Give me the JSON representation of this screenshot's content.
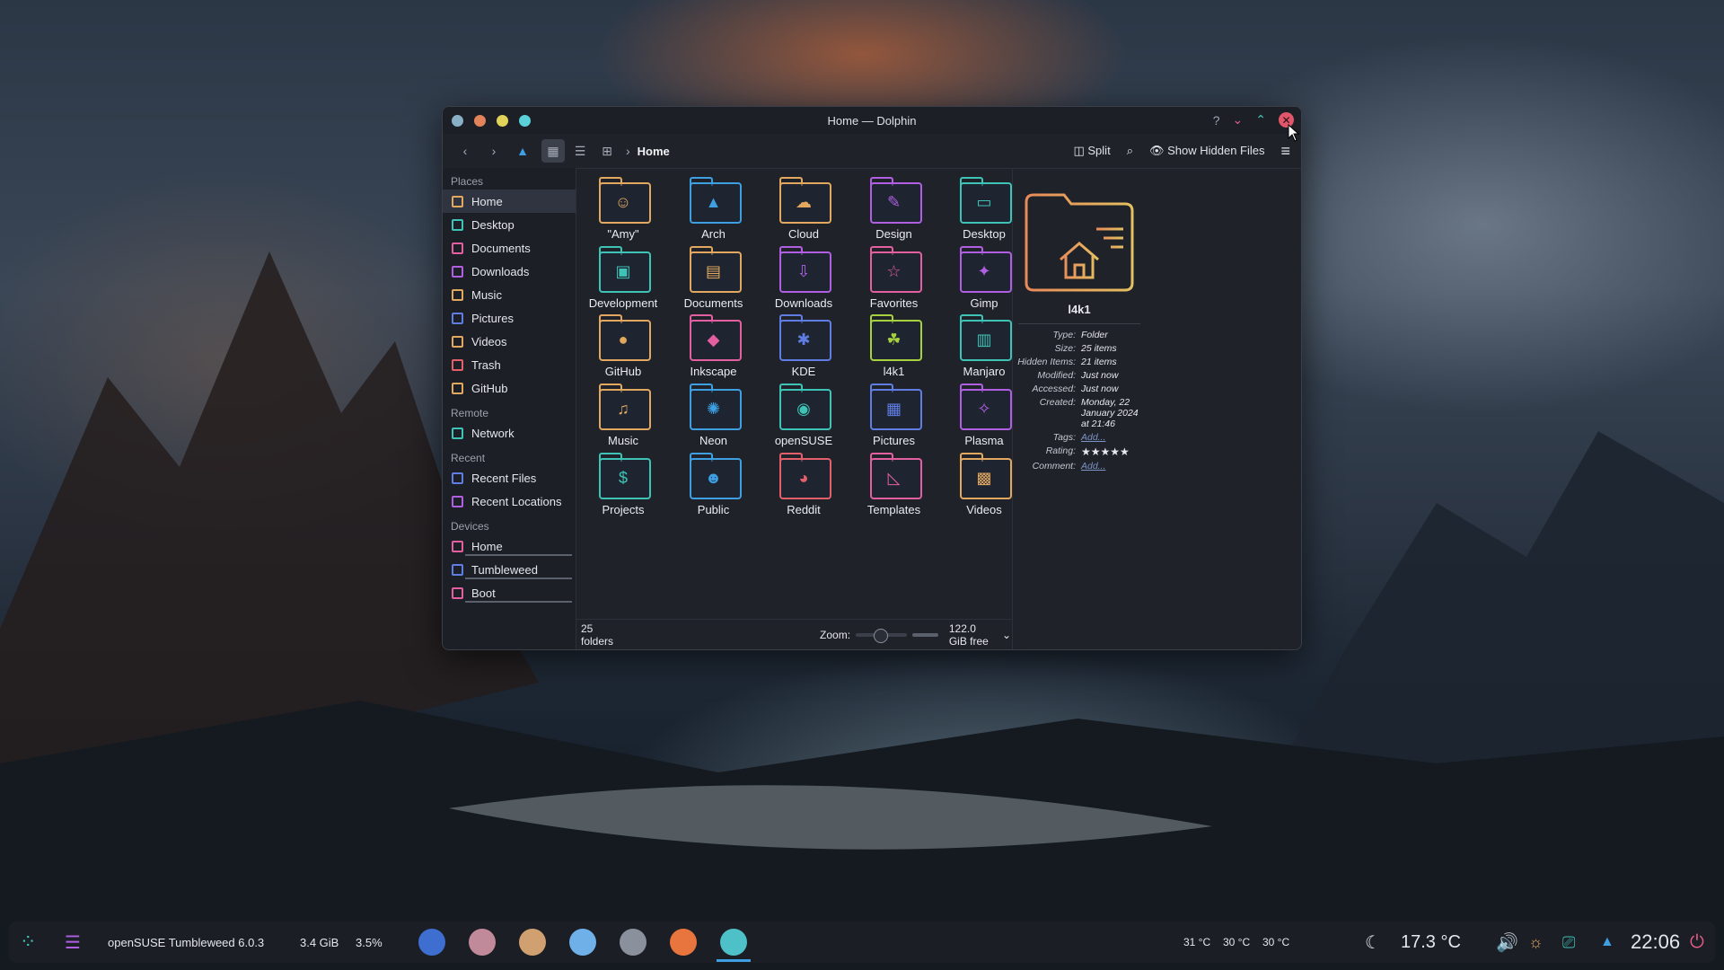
{
  "window": {
    "title": "Home — Dolphin"
  },
  "toolbar": {
    "breadcrumb": "Home",
    "split_label": "Split",
    "hidden_files_label": "Show Hidden Files"
  },
  "sidebar": {
    "places_header": "Places",
    "places": [
      {
        "label": "Home",
        "icon": "home-icon",
        "color": "#e3a860"
      },
      {
        "label": "Desktop",
        "icon": "desktop-icon",
        "color": "#3ec4b6"
      },
      {
        "label": "Documents",
        "icon": "documents-icon",
        "color": "#e35fa0"
      },
      {
        "label": "Downloads",
        "icon": "downloads-icon",
        "color": "#b05fe3"
      },
      {
        "label": "Music",
        "icon": "music-icon",
        "color": "#e3a860"
      },
      {
        "label": "Pictures",
        "icon": "pictures-icon",
        "color": "#5f7de3"
      },
      {
        "label": "Videos",
        "icon": "videos-icon",
        "color": "#e3a860"
      },
      {
        "label": "Trash",
        "icon": "trash-icon",
        "color": "#e35f6a"
      },
      {
        "label": "GitHub",
        "icon": "github-icon",
        "color": "#e3a860"
      }
    ],
    "remote_header": "Remote",
    "remote": [
      {
        "label": "Network",
        "icon": "network-icon",
        "color": "#3ec4b6"
      }
    ],
    "recent_header": "Recent",
    "recent": [
      {
        "label": "Recent Files",
        "icon": "recent-files-icon",
        "color": "#5f7de3"
      },
      {
        "label": "Recent Locations",
        "icon": "recent-locations-icon",
        "color": "#b05fe3"
      }
    ],
    "devices_header": "Devices",
    "devices": [
      {
        "label": "Home",
        "icon": "drive-icon",
        "color": "#e35fa0"
      },
      {
        "label": "Tumbleweed",
        "icon": "drive-icon",
        "color": "#5f7de3"
      },
      {
        "label": "Boot",
        "icon": "drive-icon",
        "color": "#e35fa0"
      }
    ]
  },
  "folders": [
    {
      "label": "\"Amy\"",
      "glyph": "☺",
      "color": "#e3a860"
    },
    {
      "label": "Arch",
      "glyph": "▲",
      "color": "#3e9fe3"
    },
    {
      "label": "Cloud",
      "glyph": "☁",
      "color": "#e3a860"
    },
    {
      "label": "Design",
      "glyph": "✎",
      "color": "#b05fe3"
    },
    {
      "label": "Desktop",
      "glyph": "▭",
      "color": "#3ec4b6"
    },
    {
      "label": "Development",
      "glyph": "▣",
      "color": "#3ec4b6"
    },
    {
      "label": "Documents",
      "glyph": "▤",
      "color": "#e3a860"
    },
    {
      "label": "Downloads",
      "glyph": "⇩",
      "color": "#b05fe3"
    },
    {
      "label": "Favorites",
      "glyph": "☆",
      "color": "#e35fa0"
    },
    {
      "label": "Gimp",
      "glyph": "✦",
      "color": "#b05fe3"
    },
    {
      "label": "GitHub",
      "glyph": "●",
      "color": "#e3a860"
    },
    {
      "label": "Inkscape",
      "glyph": "◆",
      "color": "#e35fa0"
    },
    {
      "label": "KDE",
      "glyph": "✱",
      "color": "#5f7de3"
    },
    {
      "label": "l4k1",
      "glyph": "☘",
      "color": "#a8d13e"
    },
    {
      "label": "Manjaro",
      "glyph": "▥",
      "color": "#3ec4b6"
    },
    {
      "label": "Music",
      "glyph": "♫",
      "color": "#e3a860"
    },
    {
      "label": "Neon",
      "glyph": "✺",
      "color": "#3e9fe3"
    },
    {
      "label": "openSUSE",
      "glyph": "◉",
      "color": "#3ec4b6"
    },
    {
      "label": "Pictures",
      "glyph": "▦",
      "color": "#5f7de3"
    },
    {
      "label": "Plasma",
      "glyph": "✧",
      "color": "#b05fe3"
    },
    {
      "label": "Projects",
      "glyph": "$",
      "color": "#3ec4b6"
    },
    {
      "label": "Public",
      "glyph": "☻",
      "color": "#3e9fe3"
    },
    {
      "label": "Reddit",
      "glyph": "◕",
      "color": "#e35f6a"
    },
    {
      "label": "Templates",
      "glyph": "◺",
      "color": "#e35fa0"
    },
    {
      "label": "Videos",
      "glyph": "▩",
      "color": "#e3a860"
    }
  ],
  "status": {
    "count": "25 folders",
    "zoom_label": "Zoom:",
    "free": "122.0 GiB free"
  },
  "info": {
    "name": "l4k1",
    "rows": [
      {
        "k": "Type:",
        "v": "Folder"
      },
      {
        "k": "Size:",
        "v": "25 items"
      },
      {
        "k": "Hidden Items:",
        "v": "21 items"
      },
      {
        "k": "Modified:",
        "v": "Just now"
      },
      {
        "k": "Accessed:",
        "v": "Just now"
      },
      {
        "k": "Created:",
        "v": "Monday, 22 January 2024 at 21:46"
      },
      {
        "k": "Tags:",
        "v": "Add..."
      },
      {
        "k": "Rating:",
        "v": "★★★★★"
      },
      {
        "k": "Comment:",
        "v": "Add..."
      }
    ]
  },
  "taskbar": {
    "distro": "openSUSE Tumbleweed 6.0.3",
    "mem": "3.4 GiB",
    "cpu": "3.5%",
    "temps": [
      "31 °C",
      "30 °C",
      "30 °C"
    ],
    "weather": "17.3 °C",
    "clock": "22:06"
  }
}
